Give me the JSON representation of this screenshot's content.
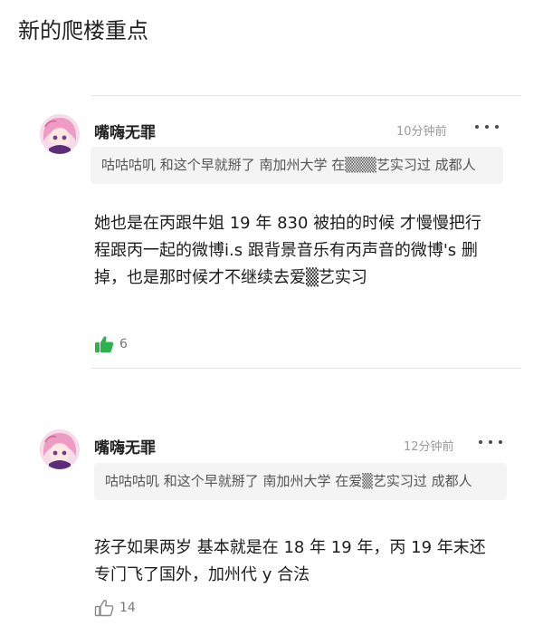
{
  "page": {
    "title": "新的爬楼重点"
  },
  "comments": [
    {
      "username": "嘴嗨无罪",
      "time": "10分钟前",
      "quote": "咕咕咕叽 和这个早就掰了 南加州大学 在▒▒▒艺实习过 成都人",
      "body": "她也是在丙跟牛姐 19 年 830 被拍的时候 才慢慢把行程跟丙一起的微博i.s 跟背景音乐有丙声音的微博's 删掉，也是那时候才不继续去爱▒艺实习",
      "likes": "6",
      "liked": true
    },
    {
      "username": "嘴嗨无罪",
      "time": "12分钟前",
      "quote": "咕咕咕叽 和这个早就掰了 南加州大学 在爱▒艺实习过 成都人",
      "body": "孩子如果两岁 基本就是在 18 年 19 年，丙 19 年末还专门飞了国外，加州代 y 合法",
      "likes": "14",
      "liked": false
    }
  ],
  "colors": {
    "like_active": "#2bb24c",
    "like_inactive": "#8a8a8a",
    "quote_bg": "#f4f4f4"
  },
  "icons": {
    "more": "more-dots-icon",
    "like": "thumbs-up-icon",
    "avatar": "anime-avatar"
  }
}
